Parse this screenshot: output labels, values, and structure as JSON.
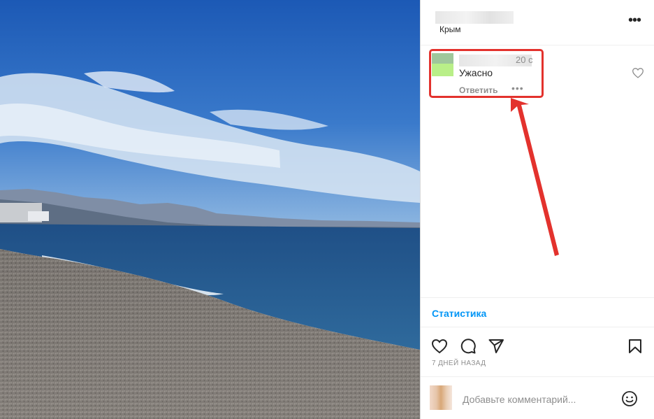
{
  "post": {
    "location": "Крым",
    "more_label": "•••"
  },
  "comment": {
    "time": "20 с",
    "text": "Ужасно",
    "reply_label": "Ответить",
    "options_label": "•••"
  },
  "stats_label": "Статистика",
  "date_label": "7 ДНЕЙ НАЗАД",
  "add_comment": {
    "placeholder": "Добавьте комментарий..."
  },
  "icons": [
    "heart-icon",
    "comment-icon",
    "share-icon",
    "bookmark-icon",
    "emoji-icon",
    "more-icon",
    "like-icon"
  ],
  "colors": {
    "accent": "#0095f6",
    "highlight": "#e3322d",
    "muted": "#8e8e8e"
  }
}
